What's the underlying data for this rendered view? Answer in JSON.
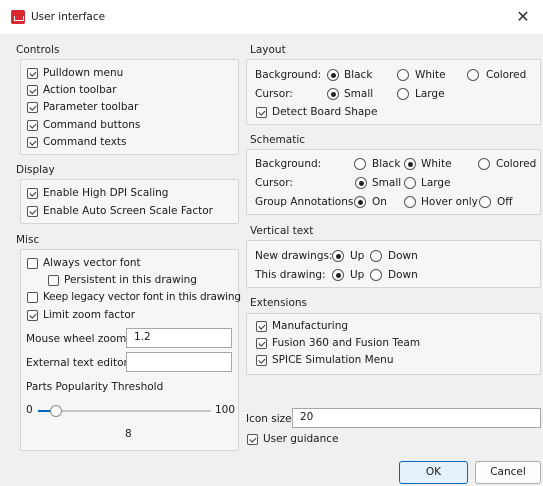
{
  "window": {
    "title": "User interface",
    "close_icon": "close-icon",
    "app_icon": "eagle-app-icon"
  },
  "controls": {
    "header": "Controls",
    "items": [
      {
        "label": "Pulldown menu",
        "checked": true
      },
      {
        "label": "Action toolbar",
        "checked": true
      },
      {
        "label": "Parameter toolbar",
        "checked": true
      },
      {
        "label": "Command buttons",
        "checked": true
      },
      {
        "label": "Command texts",
        "checked": true
      }
    ]
  },
  "display": {
    "header": "Display",
    "items": [
      {
        "label": "Enable High DPI Scaling",
        "checked": true
      },
      {
        "label": "Enable Auto Screen Scale Factor",
        "checked": true
      }
    ]
  },
  "misc": {
    "header": "Misc",
    "always_vector_font": {
      "label": "Always vector font",
      "checked": false
    },
    "persistent": {
      "label": "Persistent in this drawing",
      "checked": false
    },
    "keep_legacy": {
      "label": "Keep legacy vector font in this drawing",
      "checked": false
    },
    "limit_zoom": {
      "label": "Limit zoom factor",
      "checked": true
    },
    "mouse_wheel_zoom": {
      "label": "Mouse wheel zoom",
      "value": "1.2"
    },
    "external_text_editor": {
      "label": "External text editor",
      "value": ""
    },
    "parts_popularity": {
      "label": "Parts Popularity Threshold",
      "min": "0",
      "max": "100",
      "value": "8",
      "fraction": 0.08
    }
  },
  "layout": {
    "header": "Layout",
    "background_label": "Background:",
    "background_options": [
      {
        "label": "Black",
        "selected": true
      },
      {
        "label": "White",
        "selected": false
      },
      {
        "label": "Colored",
        "selected": false
      }
    ],
    "cursor_label": "Cursor:",
    "cursor_options": [
      {
        "label": "Small",
        "selected": true
      },
      {
        "label": "Large",
        "selected": false
      }
    ],
    "detect_board_shape": {
      "label": "Detect Board Shape",
      "checked": true
    }
  },
  "schematic": {
    "header": "Schematic",
    "background_label": "Background:",
    "background_options": [
      {
        "label": "Black",
        "selected": false
      },
      {
        "label": "White",
        "selected": true
      },
      {
        "label": "Colored",
        "selected": false
      }
    ],
    "cursor_label": "Cursor:",
    "cursor_options": [
      {
        "label": "Small",
        "selected": true
      },
      {
        "label": "Large",
        "selected": false
      }
    ],
    "group_annotations_label": "Group Annotations:",
    "group_annotations_options": [
      {
        "label": "On",
        "selected": true
      },
      {
        "label": "Hover only",
        "selected": false
      },
      {
        "label": "Off",
        "selected": false
      }
    ]
  },
  "vertical_text": {
    "header": "Vertical text",
    "new_drawings_label": "New drawings:",
    "new_drawings_options": [
      {
        "label": "Up",
        "selected": true
      },
      {
        "label": "Down",
        "selected": false
      }
    ],
    "this_drawing_label": "This drawing:",
    "this_drawing_options": [
      {
        "label": "Up",
        "selected": true
      },
      {
        "label": "Down",
        "selected": false
      }
    ]
  },
  "extensions": {
    "header": "Extensions",
    "items": [
      {
        "label": "Manufacturing",
        "checked": true
      },
      {
        "label": "Fusion 360 and Fusion Team",
        "checked": true
      },
      {
        "label": "SPICE Simulation Menu",
        "checked": true
      }
    ]
  },
  "icon_size": {
    "label": "Icon size",
    "value": "20"
  },
  "user_guidance": {
    "label": "User guidance",
    "checked": true
  },
  "buttons": {
    "ok": "OK",
    "cancel": "Cancel"
  },
  "colors": {
    "accent": "#0067c0",
    "title_bar": "#ffffff",
    "dialog_bg": "#f0f0f0"
  }
}
